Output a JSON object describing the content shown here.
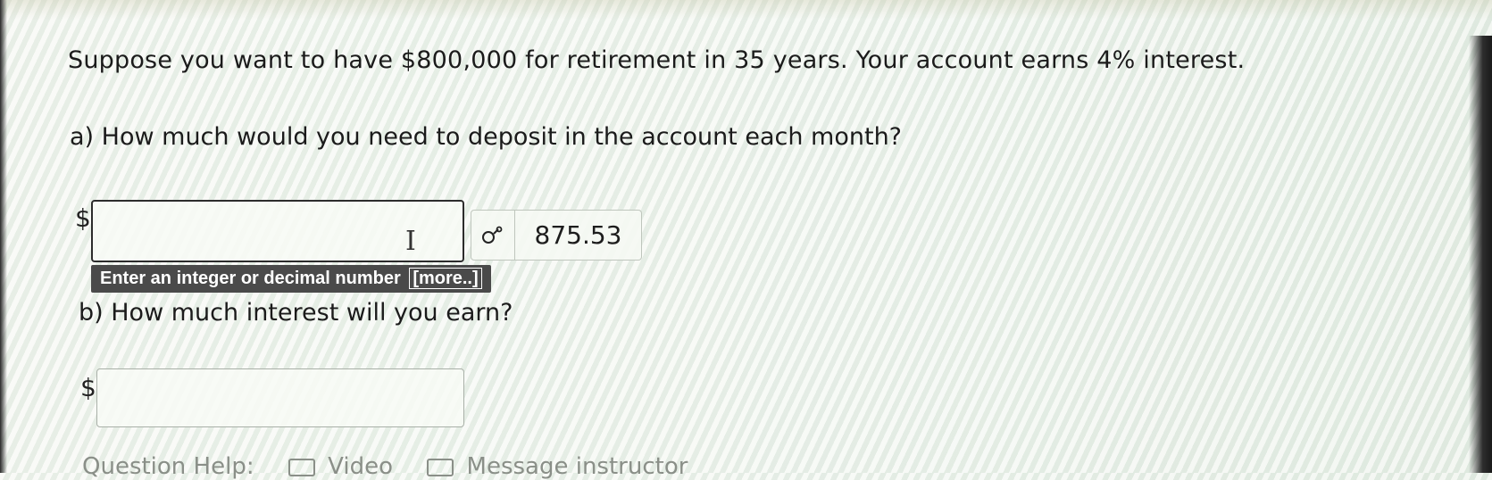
{
  "question": {
    "prompt": "Suppose you want to have $800,000 for retirement in 35 years. Your account earns 4% interest.",
    "part_a": {
      "label": "a) How much would you need to deposit in the account each month?",
      "currency_symbol": "$",
      "input_value": "",
      "preview_value": "875.53",
      "preview_icon": "formula-preview-icon",
      "hint_text": "Enter an integer or decimal number",
      "hint_more": "[more..]"
    },
    "part_b": {
      "label": "b) How much interest will you earn?",
      "currency_symbol": "$",
      "input_value": ""
    }
  },
  "help": {
    "label": "Question Help:",
    "video_label": "Video",
    "message_label": "Message instructor"
  }
}
